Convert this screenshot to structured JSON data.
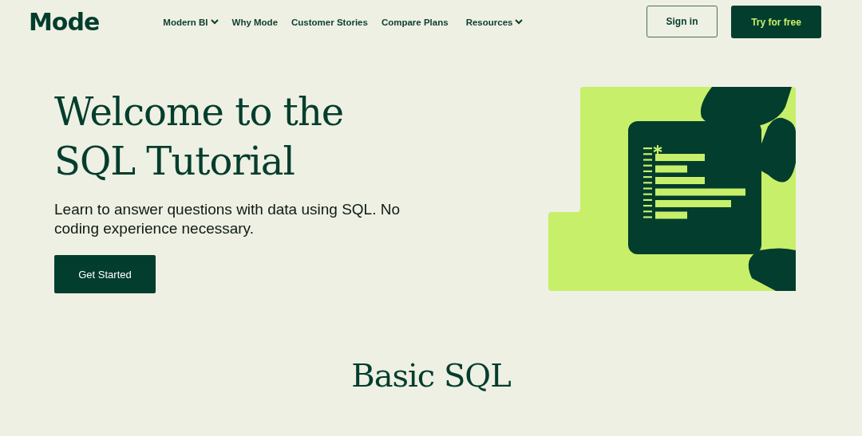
{
  "header": {
    "logo": "Mode",
    "nav": [
      {
        "label": "Modern BI",
        "has_menu": true
      },
      {
        "label": "Why Mode",
        "has_menu": false
      },
      {
        "label": "Customer Stories",
        "has_menu": false
      },
      {
        "label": "Compare Plans",
        "has_menu": false
      },
      {
        "label": "Resources",
        "has_menu": true
      }
    ],
    "sign_in": "Sign in",
    "try_free": "Try for free"
  },
  "hero": {
    "title_lines": [
      "Welcome to the",
      "SQL Tutorial"
    ],
    "subtitle": "Learn to answer questions with data using SQL. No coding experience necessary.",
    "cta": "Get Started"
  },
  "section_title": "Basic SQL"
}
